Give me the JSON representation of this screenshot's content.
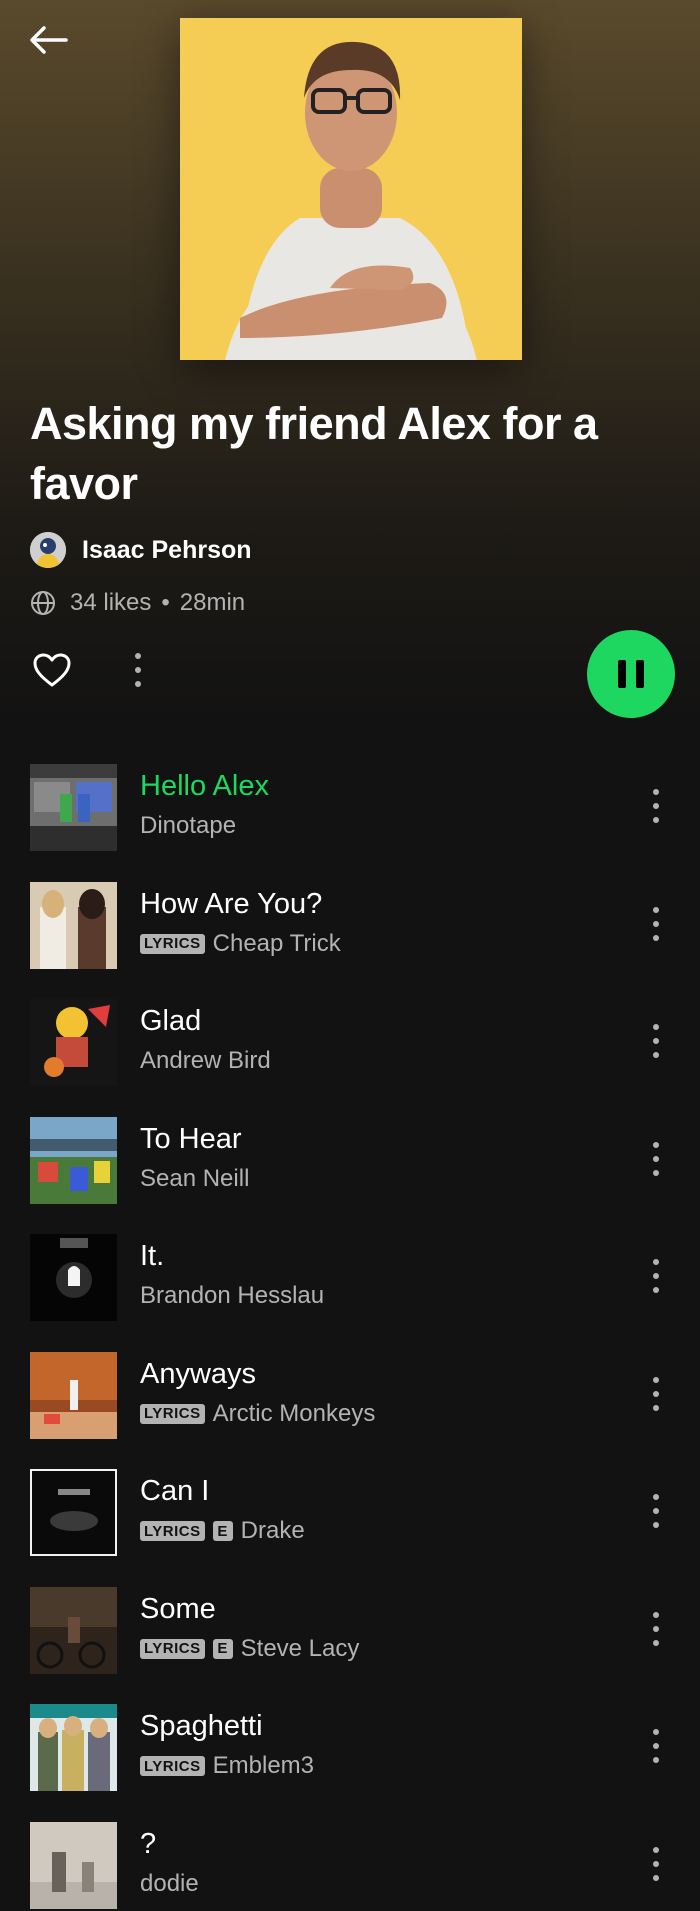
{
  "header": {
    "back_icon": "arrow-left-icon"
  },
  "playlist": {
    "title": "Asking my friend Alex for a favor",
    "owner": "Isaac Pehrson",
    "likes": "34 likes",
    "separator": "•",
    "duration": "28min",
    "visibility_icon": "globe-icon"
  },
  "controls": {
    "like_icon": "heart-outline-icon",
    "more_icon": "more-vertical-icon",
    "play_icon": "pause-icon",
    "accent_color": "#1ed760"
  },
  "badges": {
    "lyrics": "LYRICS",
    "explicit": "E"
  },
  "tracks": [
    {
      "title": "Hello Alex",
      "artist": "Dinotape",
      "lyrics": false,
      "explicit": false,
      "playing": true
    },
    {
      "title": "How Are You?",
      "artist": "Cheap Trick",
      "lyrics": true,
      "explicit": false,
      "playing": false
    },
    {
      "title": "Glad",
      "artist": "Andrew Bird",
      "lyrics": false,
      "explicit": false,
      "playing": false
    },
    {
      "title": "To Hear",
      "artist": "Sean Neill",
      "lyrics": false,
      "explicit": false,
      "playing": false
    },
    {
      "title": "It.",
      "artist": "Brandon Hesslau",
      "lyrics": false,
      "explicit": false,
      "playing": false
    },
    {
      "title": "Anyways",
      "artist": "Arctic Monkeys",
      "lyrics": true,
      "explicit": false,
      "playing": false
    },
    {
      "title": "Can I",
      "artist": "Drake",
      "lyrics": true,
      "explicit": true,
      "playing": false
    },
    {
      "title": "Some",
      "artist": "Steve Lacy",
      "lyrics": true,
      "explicit": true,
      "playing": false
    },
    {
      "title": "Spaghetti",
      "artist": "Emblem3",
      "lyrics": true,
      "explicit": false,
      "playing": false
    },
    {
      "title": "?",
      "artist": "dodie",
      "lyrics": false,
      "explicit": false,
      "playing": false
    }
  ]
}
